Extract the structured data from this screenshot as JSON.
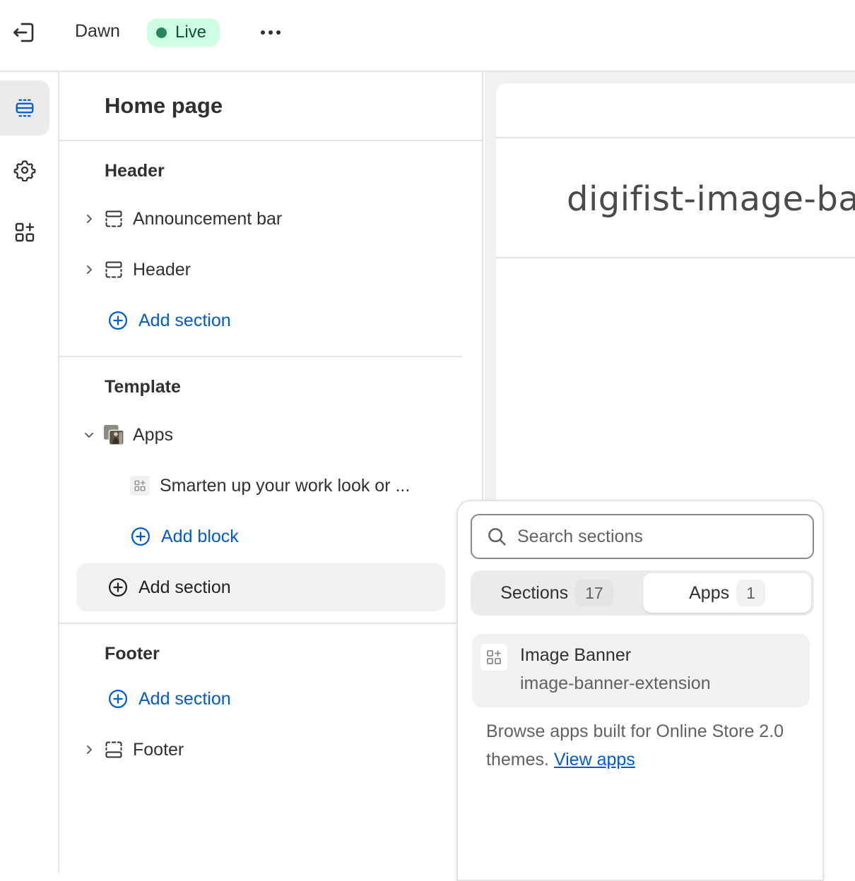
{
  "topbar": {
    "theme_name": "Dawn",
    "status": "Live",
    "status_color": "#29845a"
  },
  "rail": {
    "items": [
      {
        "icon": "sections-icon",
        "active": true
      },
      {
        "icon": "gear-icon",
        "active": false
      },
      {
        "icon": "apps-icon",
        "active": false
      }
    ]
  },
  "sidebar": {
    "title": "Home page",
    "header_group": {
      "title": "Header",
      "items": [
        "Announcement bar",
        "Header"
      ],
      "add_label": "Add section"
    },
    "template_group": {
      "title": "Template",
      "section": "Apps",
      "block": "Smarten up your work look or ...",
      "add_block_label": "Add block",
      "add_section_label": "Add section"
    },
    "footer_group": {
      "title": "Footer",
      "add_label": "Add section",
      "items": [
        "Footer"
      ]
    }
  },
  "preview": {
    "heading": "digifist-image-bann"
  },
  "popover": {
    "search_placeholder": "Search sections",
    "tabs": [
      {
        "label": "Sections",
        "count": "17",
        "selected": false
      },
      {
        "label": "Apps",
        "count": "1",
        "selected": true
      }
    ],
    "app_item": {
      "name": "Image Banner",
      "handle": "image-banner-extension"
    },
    "browse_text": "Browse apps built for Online Store 2.0 themes.",
    "browse_link": "View apps"
  },
  "colors": {
    "accent": "#005bd3",
    "live_badge_bg": "#cdfee1"
  }
}
